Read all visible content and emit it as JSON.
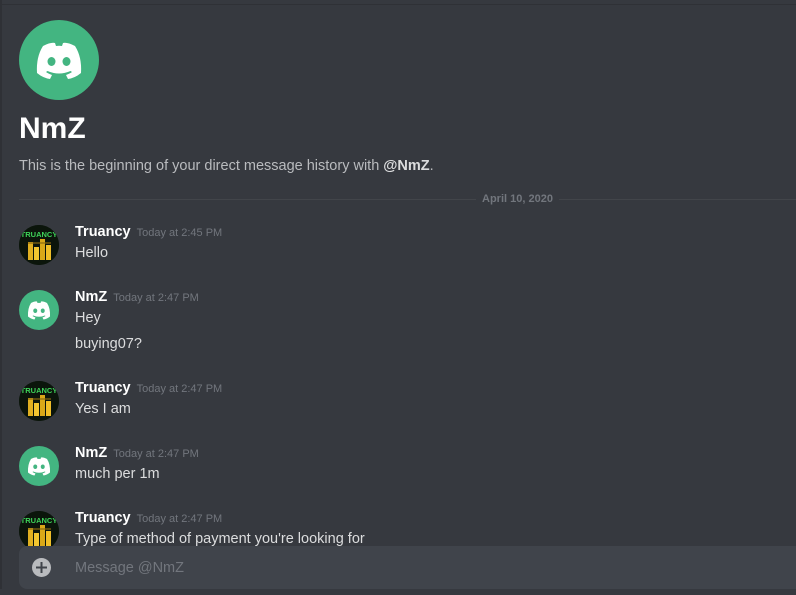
{
  "channel": {
    "name": "NmZ",
    "intro_prefix": "This is the beginning of your direct message history with ",
    "intro_mention": "@NmZ",
    "intro_suffix": ".",
    "avatar_icon": "discord-logo-icon",
    "avatar_color": "#43b581"
  },
  "date_divider": "April 10, 2020",
  "messages": [
    {
      "author": "Truancy",
      "time": "Today at 2:45 PM",
      "avatar": "truancy-avatar",
      "lines": [
        "Hello"
      ]
    },
    {
      "author": "NmZ",
      "time": "Today at 2:47 PM",
      "avatar": "discord-logo-icon",
      "lines": [
        "Hey",
        "buying07?"
      ]
    },
    {
      "author": "Truancy",
      "time": "Today at 2:47 PM",
      "avatar": "truancy-avatar",
      "lines": [
        "Yes I am"
      ]
    },
    {
      "author": "NmZ",
      "time": "Today at 2:47 PM",
      "avatar": "discord-logo-icon",
      "lines": [
        "much per 1m"
      ]
    },
    {
      "author": "Truancy",
      "time": "Today at 2:47 PM",
      "avatar": "truancy-avatar",
      "lines": [
        "Type of method of payment you're looking for"
      ]
    }
  ],
  "composer": {
    "placeholder": "Message @NmZ",
    "add_icon": "plus-circle-icon"
  },
  "colors": {
    "background": "#36393f",
    "composer": "#40444b",
    "accent_green": "#43b581"
  }
}
